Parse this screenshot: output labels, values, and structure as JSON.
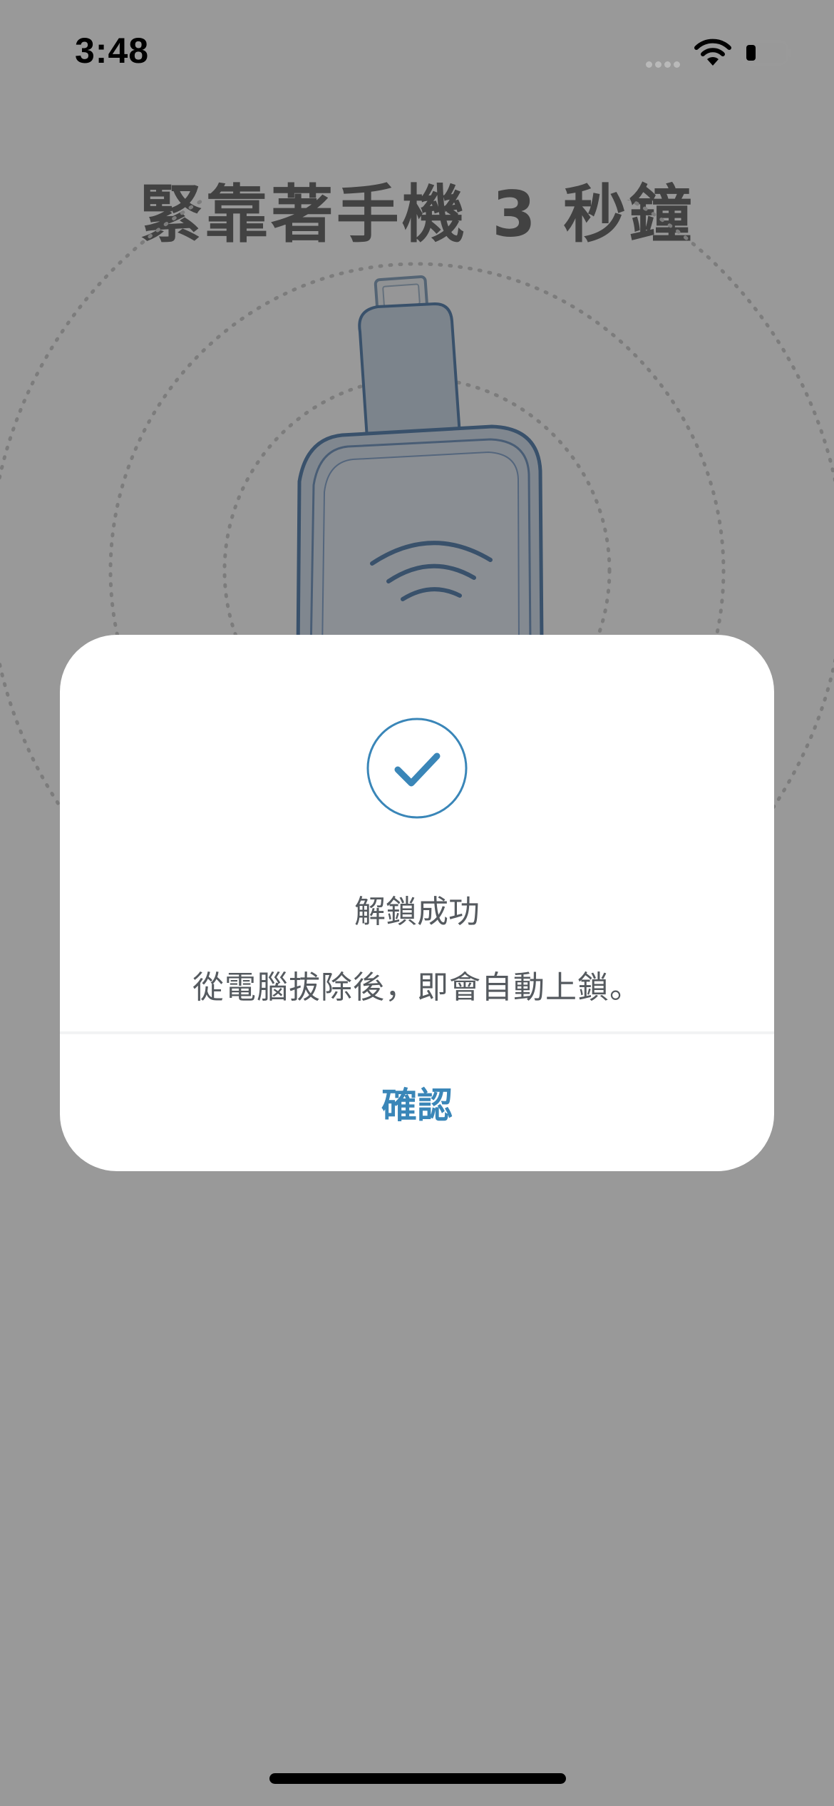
{
  "status_bar": {
    "time": "3:48",
    "icons": [
      "signal-icon",
      "wifi-icon",
      "battery-icon"
    ],
    "battery_level": 0.25
  },
  "page": {
    "title": "緊靠著手機 3 秒鐘",
    "illustration_icon": "usb-key-nfc-icon"
  },
  "dialog": {
    "icon": "checkmark-circle-icon",
    "title": "解鎖成功",
    "message": "從電腦拔除後，即會自動上鎖。",
    "confirm_label": "確認"
  },
  "colors": {
    "accent": "#3a86b8",
    "overlay": "rgba(0,0,0,0.40)",
    "dialog_text": "#555a5f",
    "device_stroke": "#4f86c6"
  }
}
